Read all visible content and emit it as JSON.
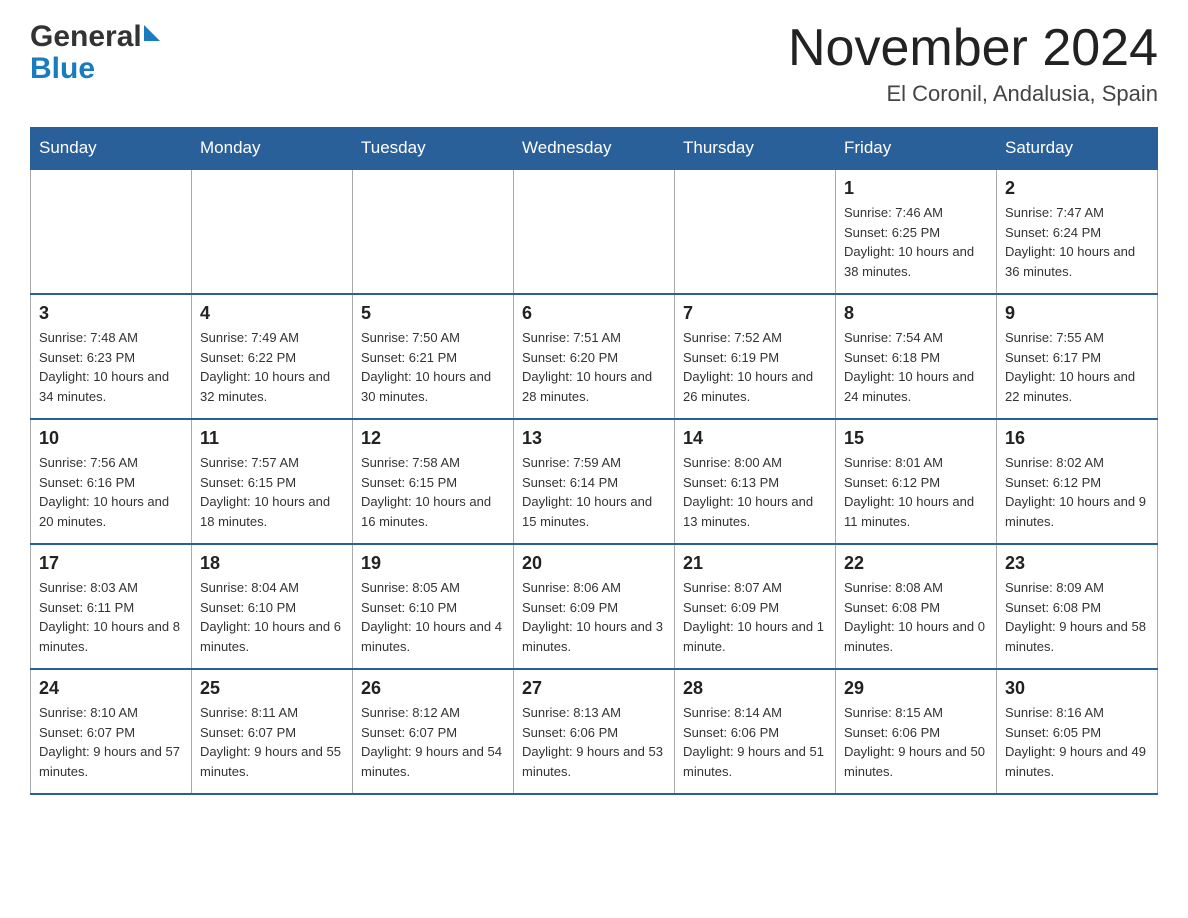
{
  "header": {
    "logo_general": "General",
    "logo_blue": "Blue",
    "month_year": "November 2024",
    "location": "El Coronil, Andalusia, Spain"
  },
  "weekdays": [
    "Sunday",
    "Monday",
    "Tuesday",
    "Wednesday",
    "Thursday",
    "Friday",
    "Saturday"
  ],
  "weeks": [
    [
      {
        "day": "",
        "sunrise": "",
        "sunset": "",
        "daylight": ""
      },
      {
        "day": "",
        "sunrise": "",
        "sunset": "",
        "daylight": ""
      },
      {
        "day": "",
        "sunrise": "",
        "sunset": "",
        "daylight": ""
      },
      {
        "day": "",
        "sunrise": "",
        "sunset": "",
        "daylight": ""
      },
      {
        "day": "",
        "sunrise": "",
        "sunset": "",
        "daylight": ""
      },
      {
        "day": "1",
        "sunrise": "Sunrise: 7:46 AM",
        "sunset": "Sunset: 6:25 PM",
        "daylight": "Daylight: 10 hours and 38 minutes."
      },
      {
        "day": "2",
        "sunrise": "Sunrise: 7:47 AM",
        "sunset": "Sunset: 6:24 PM",
        "daylight": "Daylight: 10 hours and 36 minutes."
      }
    ],
    [
      {
        "day": "3",
        "sunrise": "Sunrise: 7:48 AM",
        "sunset": "Sunset: 6:23 PM",
        "daylight": "Daylight: 10 hours and 34 minutes."
      },
      {
        "day": "4",
        "sunrise": "Sunrise: 7:49 AM",
        "sunset": "Sunset: 6:22 PM",
        "daylight": "Daylight: 10 hours and 32 minutes."
      },
      {
        "day": "5",
        "sunrise": "Sunrise: 7:50 AM",
        "sunset": "Sunset: 6:21 PM",
        "daylight": "Daylight: 10 hours and 30 minutes."
      },
      {
        "day": "6",
        "sunrise": "Sunrise: 7:51 AM",
        "sunset": "Sunset: 6:20 PM",
        "daylight": "Daylight: 10 hours and 28 minutes."
      },
      {
        "day": "7",
        "sunrise": "Sunrise: 7:52 AM",
        "sunset": "Sunset: 6:19 PM",
        "daylight": "Daylight: 10 hours and 26 minutes."
      },
      {
        "day": "8",
        "sunrise": "Sunrise: 7:54 AM",
        "sunset": "Sunset: 6:18 PM",
        "daylight": "Daylight: 10 hours and 24 minutes."
      },
      {
        "day": "9",
        "sunrise": "Sunrise: 7:55 AM",
        "sunset": "Sunset: 6:17 PM",
        "daylight": "Daylight: 10 hours and 22 minutes."
      }
    ],
    [
      {
        "day": "10",
        "sunrise": "Sunrise: 7:56 AM",
        "sunset": "Sunset: 6:16 PM",
        "daylight": "Daylight: 10 hours and 20 minutes."
      },
      {
        "day": "11",
        "sunrise": "Sunrise: 7:57 AM",
        "sunset": "Sunset: 6:15 PM",
        "daylight": "Daylight: 10 hours and 18 minutes."
      },
      {
        "day": "12",
        "sunrise": "Sunrise: 7:58 AM",
        "sunset": "Sunset: 6:15 PM",
        "daylight": "Daylight: 10 hours and 16 minutes."
      },
      {
        "day": "13",
        "sunrise": "Sunrise: 7:59 AM",
        "sunset": "Sunset: 6:14 PM",
        "daylight": "Daylight: 10 hours and 15 minutes."
      },
      {
        "day": "14",
        "sunrise": "Sunrise: 8:00 AM",
        "sunset": "Sunset: 6:13 PM",
        "daylight": "Daylight: 10 hours and 13 minutes."
      },
      {
        "day": "15",
        "sunrise": "Sunrise: 8:01 AM",
        "sunset": "Sunset: 6:12 PM",
        "daylight": "Daylight: 10 hours and 11 minutes."
      },
      {
        "day": "16",
        "sunrise": "Sunrise: 8:02 AM",
        "sunset": "Sunset: 6:12 PM",
        "daylight": "Daylight: 10 hours and 9 minutes."
      }
    ],
    [
      {
        "day": "17",
        "sunrise": "Sunrise: 8:03 AM",
        "sunset": "Sunset: 6:11 PM",
        "daylight": "Daylight: 10 hours and 8 minutes."
      },
      {
        "day": "18",
        "sunrise": "Sunrise: 8:04 AM",
        "sunset": "Sunset: 6:10 PM",
        "daylight": "Daylight: 10 hours and 6 minutes."
      },
      {
        "day": "19",
        "sunrise": "Sunrise: 8:05 AM",
        "sunset": "Sunset: 6:10 PM",
        "daylight": "Daylight: 10 hours and 4 minutes."
      },
      {
        "day": "20",
        "sunrise": "Sunrise: 8:06 AM",
        "sunset": "Sunset: 6:09 PM",
        "daylight": "Daylight: 10 hours and 3 minutes."
      },
      {
        "day": "21",
        "sunrise": "Sunrise: 8:07 AM",
        "sunset": "Sunset: 6:09 PM",
        "daylight": "Daylight: 10 hours and 1 minute."
      },
      {
        "day": "22",
        "sunrise": "Sunrise: 8:08 AM",
        "sunset": "Sunset: 6:08 PM",
        "daylight": "Daylight: 10 hours and 0 minutes."
      },
      {
        "day": "23",
        "sunrise": "Sunrise: 8:09 AM",
        "sunset": "Sunset: 6:08 PM",
        "daylight": "Daylight: 9 hours and 58 minutes."
      }
    ],
    [
      {
        "day": "24",
        "sunrise": "Sunrise: 8:10 AM",
        "sunset": "Sunset: 6:07 PM",
        "daylight": "Daylight: 9 hours and 57 minutes."
      },
      {
        "day": "25",
        "sunrise": "Sunrise: 8:11 AM",
        "sunset": "Sunset: 6:07 PM",
        "daylight": "Daylight: 9 hours and 55 minutes."
      },
      {
        "day": "26",
        "sunrise": "Sunrise: 8:12 AM",
        "sunset": "Sunset: 6:07 PM",
        "daylight": "Daylight: 9 hours and 54 minutes."
      },
      {
        "day": "27",
        "sunrise": "Sunrise: 8:13 AM",
        "sunset": "Sunset: 6:06 PM",
        "daylight": "Daylight: 9 hours and 53 minutes."
      },
      {
        "day": "28",
        "sunrise": "Sunrise: 8:14 AM",
        "sunset": "Sunset: 6:06 PM",
        "daylight": "Daylight: 9 hours and 51 minutes."
      },
      {
        "day": "29",
        "sunrise": "Sunrise: 8:15 AM",
        "sunset": "Sunset: 6:06 PM",
        "daylight": "Daylight: 9 hours and 50 minutes."
      },
      {
        "day": "30",
        "sunrise": "Sunrise: 8:16 AM",
        "sunset": "Sunset: 6:05 PM",
        "daylight": "Daylight: 9 hours and 49 minutes."
      }
    ]
  ]
}
